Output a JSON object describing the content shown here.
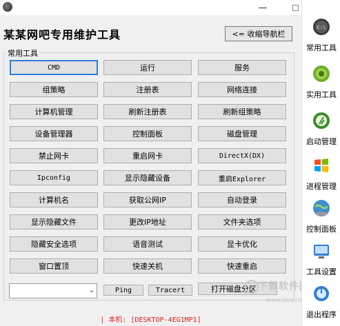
{
  "window": {
    "minimize_glyph": "—",
    "close_glyph": "✕"
  },
  "header": {
    "title": "某某网吧专用维护工具",
    "collapse_label": "<= 收缩导航栏"
  },
  "tools": {
    "group_label": "常用工具",
    "buttons": [
      "CMD",
      "运行",
      "服务",
      "组策略",
      "注册表",
      "网络连接",
      "计算机管理",
      "刷新注册表",
      "刷新组策略",
      "设备管理器",
      "控制面板",
      "磁盘管理",
      "禁止网卡",
      "重启网卡",
      "DirectX(DX)",
      "Ipconfig",
      "显示隐藏设备",
      "重启Explorer",
      "计算机名",
      "获取公网IP",
      "自动登录",
      "显示隐藏文件",
      "更改IP地址",
      "文件夹选项",
      "隐藏安全选项",
      "语音测试",
      "显卡优化",
      "窗口置顶",
      "快速关机",
      "快速重启"
    ]
  },
  "bottom": {
    "combo_value": "",
    "ping_label": "Ping",
    "tracert_label": "Tracert",
    "disk_label": "打开磁盘分区"
  },
  "status": {
    "text": "| 本机: [DESKTOP-4EG1MP1]"
  },
  "watermark": {
    "text": "下载软件园",
    "url": "www.downxia.com"
  },
  "sidebar": {
    "items": [
      {
        "label": "常用工具",
        "icon": "cmd-icon"
      },
      {
        "label": "实用工具",
        "icon": "gear-icon"
      },
      {
        "label": "启动管理",
        "icon": "startup-icon"
      },
      {
        "label": "进程管理",
        "icon": "windows-icon"
      },
      {
        "label": "控制面板",
        "icon": "globe-icon"
      },
      {
        "label": "工具设置",
        "icon": "settings-icon"
      },
      {
        "label": "退出程序",
        "icon": "exit-icon"
      }
    ]
  },
  "colors": {
    "status_text": "#e02020",
    "selected_border": "#2a7fd6",
    "panel_bg": "#f0f0f0"
  }
}
